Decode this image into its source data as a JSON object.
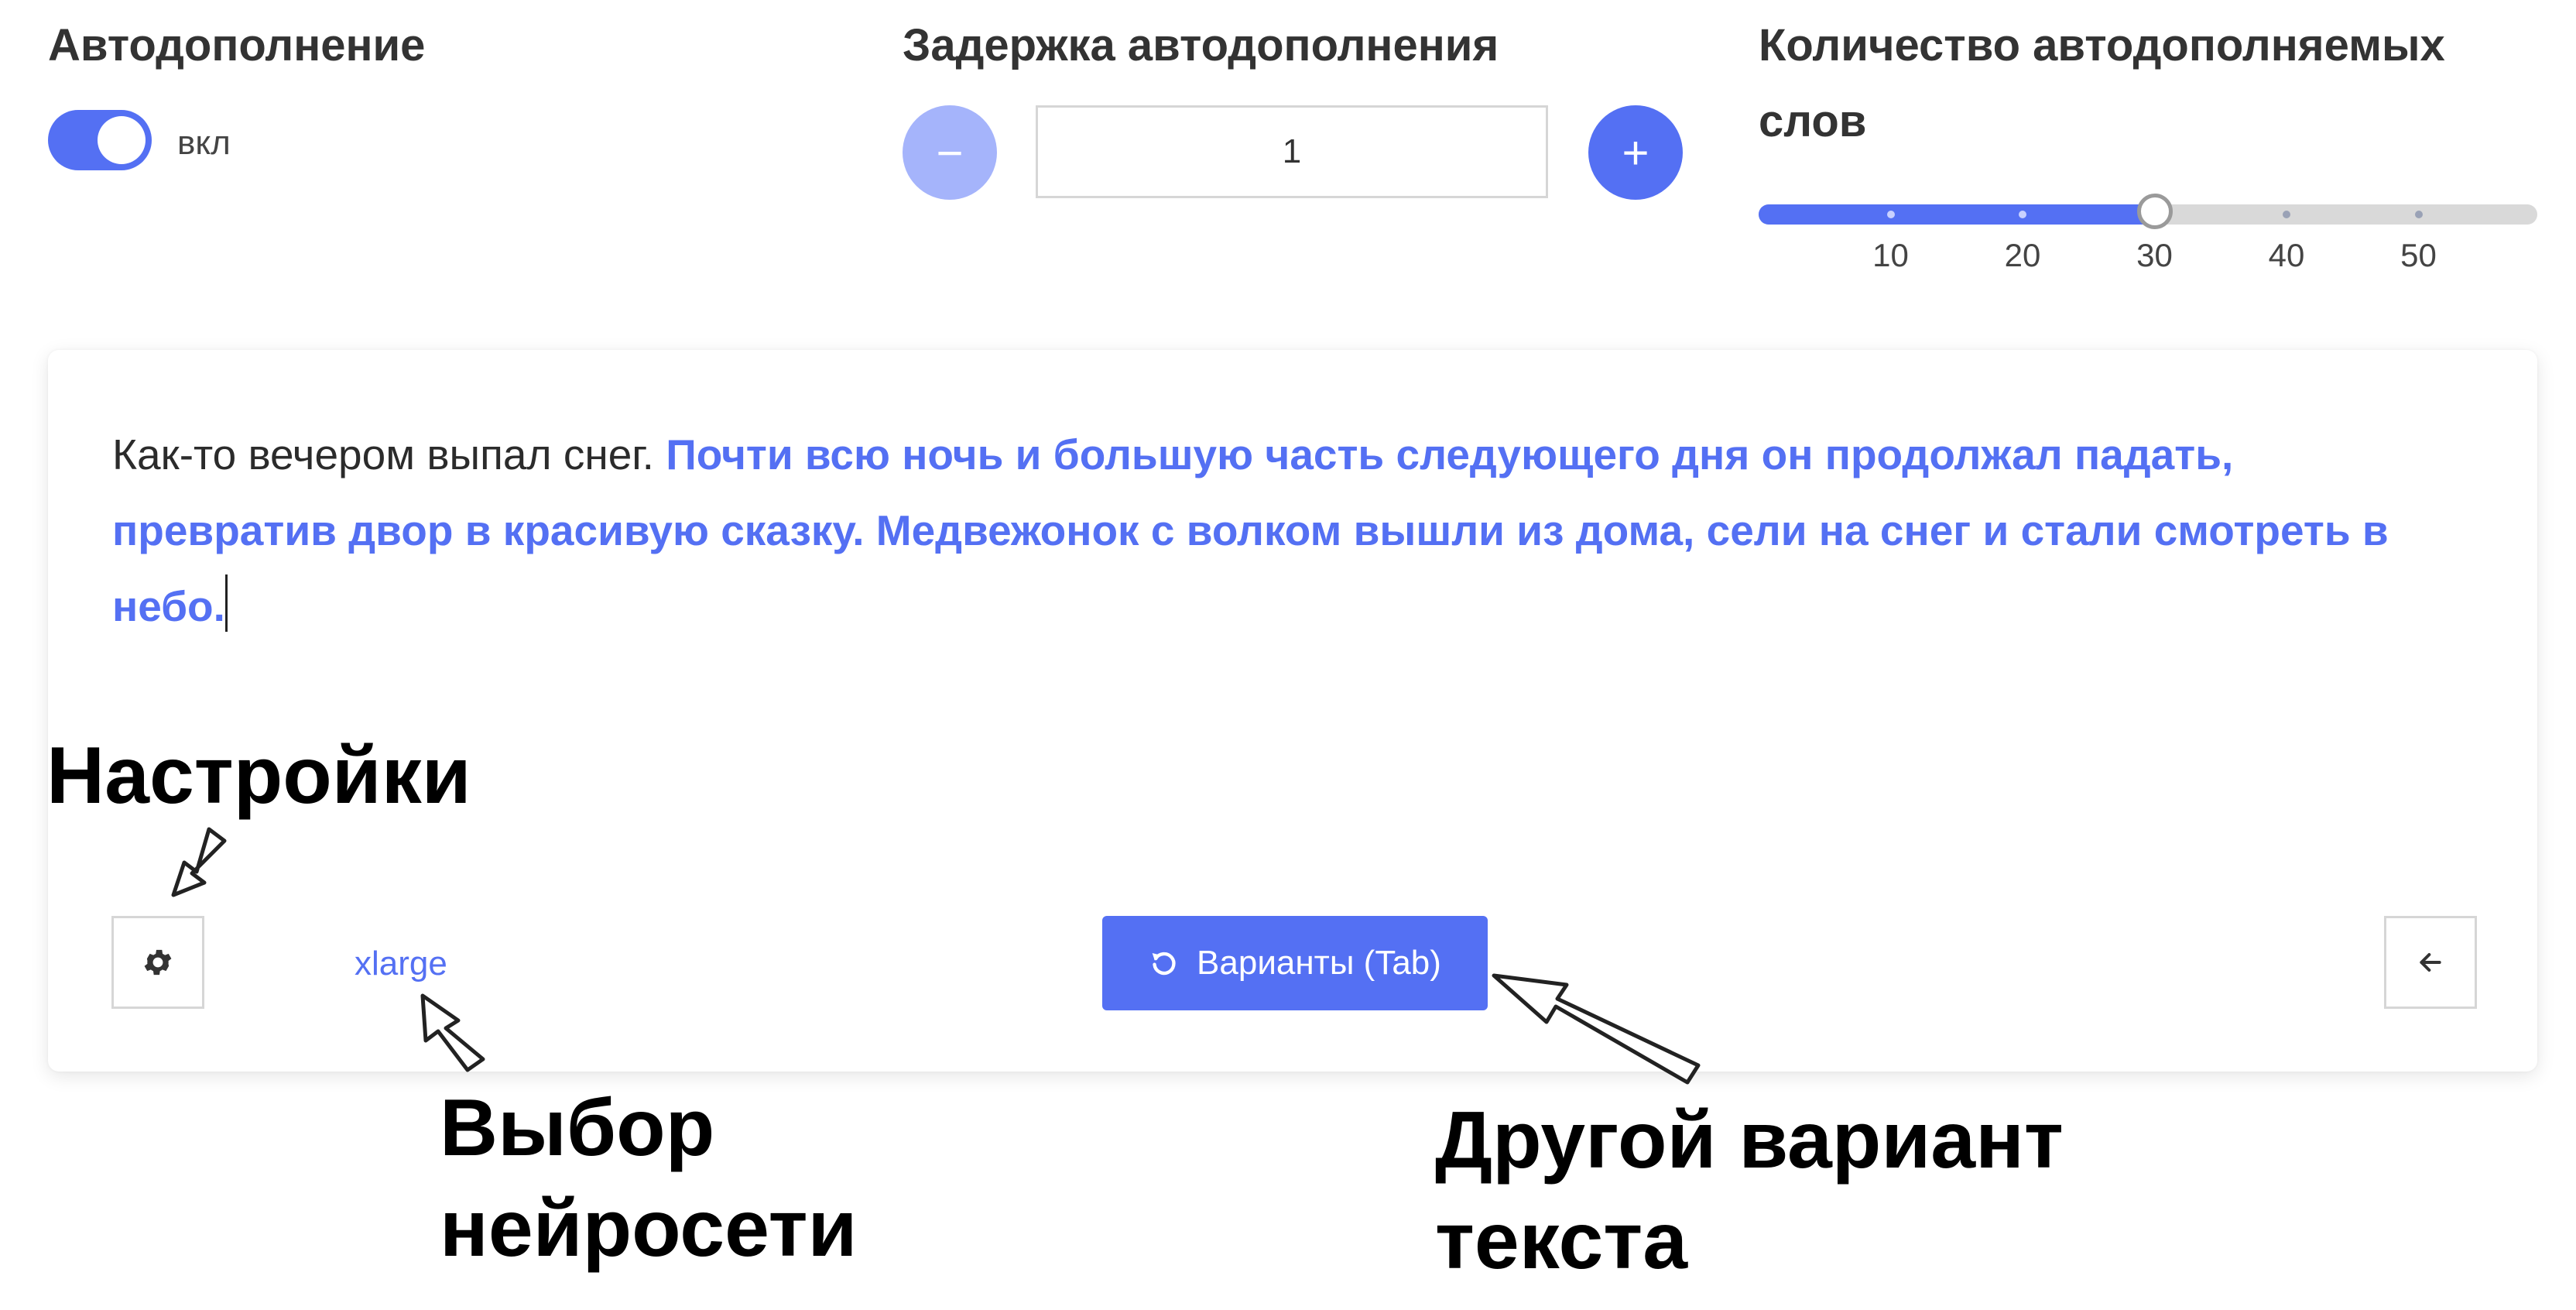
{
  "autocomplete": {
    "title": "Автодополнение",
    "toggle_state": "on",
    "toggle_label": "вкл"
  },
  "delay": {
    "title": "Задержка автодополнения",
    "value": "1",
    "minus_symbol": "−",
    "plus_symbol": "+"
  },
  "word_count": {
    "title_line1": "Количество автодополняемых",
    "title_line2": "слов",
    "marks": [
      "10",
      "20",
      "30",
      "40",
      "50"
    ],
    "value": 30,
    "min": 0,
    "max": 59
  },
  "editor": {
    "prefix_text": "Как-то вечером выпал снег. ",
    "suggestion_text": "Почти всю ночь и большую часть следующего дня он продолжал падать, превратив двор в красивую сказку.  Медвежонок с волком вышли из дома, сели на снег и стали смотреть в небо."
  },
  "toolbar": {
    "settings_icon": "gear-icon",
    "model_label": "xlarge",
    "variants_icon": "refresh-icon",
    "variants_label": "Варианты (Tab)",
    "back_icon": "arrow-left-icon"
  },
  "annotations": {
    "settings": "Настройки",
    "model_line1": "Выбор",
    "model_line2": "нейросети",
    "variant_line1": "Другой вариант",
    "variant_line2": "текста"
  },
  "colors": {
    "accent": "#5470f3",
    "accent_light": "#a5b4fb",
    "rail": "#d9d9d9",
    "border": "#d6d6d6"
  }
}
